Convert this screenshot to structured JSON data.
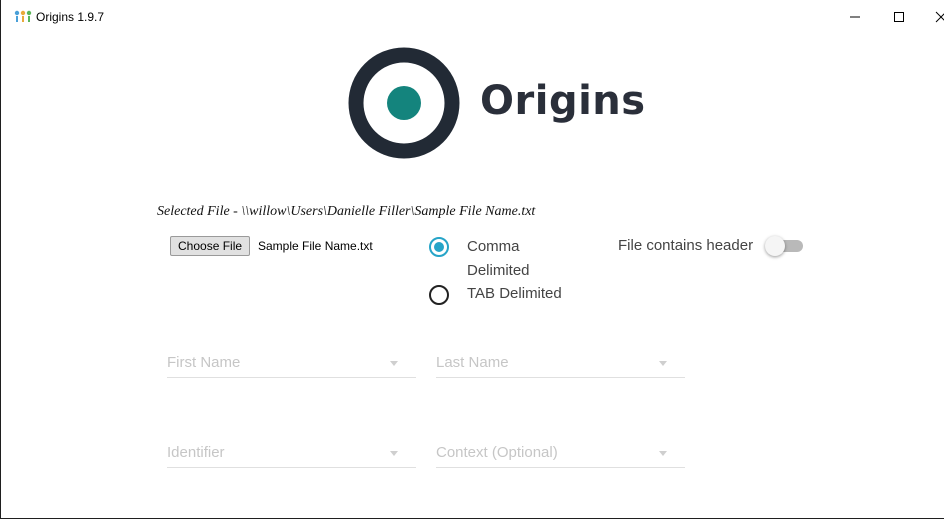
{
  "window": {
    "title": "Origins 1.9.7",
    "icon": "app-icon",
    "controls": {
      "minimize": "minimize-icon",
      "maximize": "maximize-icon",
      "close": "close-icon"
    }
  },
  "logo": {
    "text": "Origins",
    "ring_color": "#222a35",
    "dot_color": "#14847d"
  },
  "file": {
    "selected_prefix": "Selected File - ",
    "selected_path": "\\\\willow\\Users\\Danielle Filler\\Sample File Name.txt",
    "choose_label": "Choose File",
    "chosen_name": "Sample File Name.txt"
  },
  "delimiter": {
    "options": [
      {
        "label": "Comma Delimited",
        "selected": true
      },
      {
        "label": "TAB Delimited",
        "selected": false
      }
    ],
    "accent": "#26a4c8"
  },
  "header_toggle": {
    "label": "File contains header",
    "checked": false
  },
  "fields": {
    "first_name": "First Name",
    "last_name": "Last Name",
    "identifier": "Identifier",
    "context": "Context (Optional)"
  }
}
